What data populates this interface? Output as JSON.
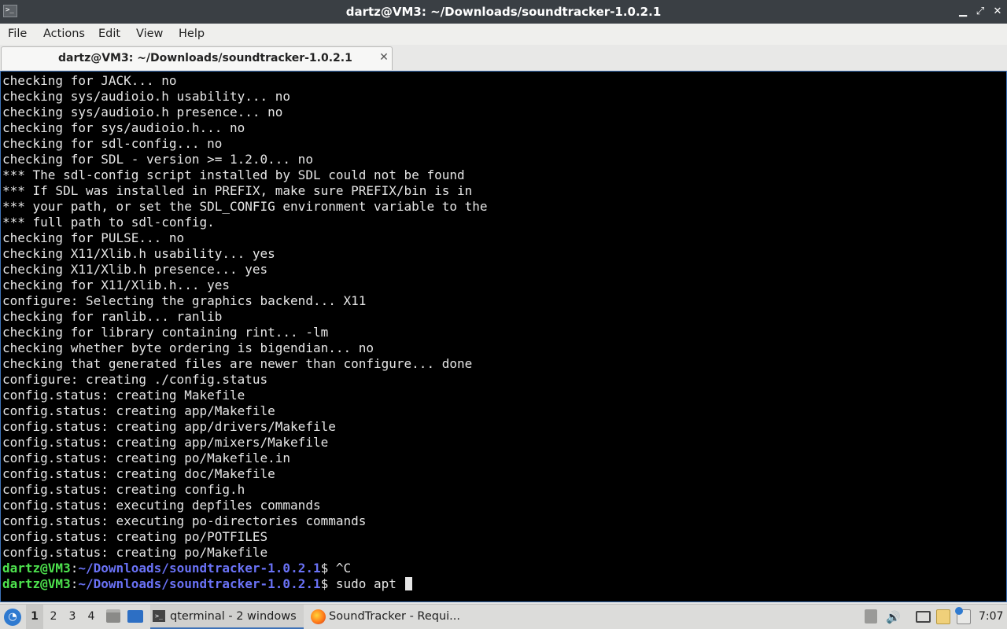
{
  "window": {
    "title": "dartz@VM3: ~/Downloads/soundtracker-1.0.2.1",
    "controls": {
      "minimize": "▁",
      "maximize": "⤢",
      "close": "✕"
    }
  },
  "menubar": {
    "items": [
      "File",
      "Actions",
      "Edit",
      "View",
      "Help"
    ]
  },
  "tabs": [
    {
      "label": "dartz@VM3: ~/Downloads/soundtracker-1.0.2.1",
      "active": true
    }
  ],
  "terminal": {
    "lines": [
      "checking for JACK... no",
      "checking sys/audioio.h usability... no",
      "checking sys/audioio.h presence... no",
      "checking for sys/audioio.h... no",
      "checking for sdl-config... no",
      "checking for SDL - version >= 1.2.0... no",
      "*** The sdl-config script installed by SDL could not be found",
      "*** If SDL was installed in PREFIX, make sure PREFIX/bin is in",
      "*** your path, or set the SDL_CONFIG environment variable to the",
      "*** full path to sdl-config.",
      "checking for PULSE... no",
      "checking X11/Xlib.h usability... yes",
      "checking X11/Xlib.h presence... yes",
      "checking for X11/Xlib.h... yes",
      "configure: Selecting the graphics backend... X11",
      "checking for ranlib... ranlib",
      "checking for library containing rint... -lm",
      "checking whether byte ordering is bigendian... no",
      "checking that generated files are newer than configure... done",
      "configure: creating ./config.status",
      "config.status: creating Makefile",
      "config.status: creating app/Makefile",
      "config.status: creating app/drivers/Makefile",
      "config.status: creating app/mixers/Makefile",
      "config.status: creating po/Makefile.in",
      "config.status: creating doc/Makefile",
      "config.status: creating config.h",
      "config.status: executing depfiles commands",
      "config.status: executing po-directories commands",
      "config.status: creating po/POTFILES",
      "config.status: creating po/Makefile"
    ],
    "prompts": [
      {
        "user": "dartz@VM3",
        "sep": ":",
        "path": "~/Downloads/soundtracker-1.0.2.1",
        "symbol": "$ ",
        "command": "^C"
      },
      {
        "user": "dartz@VM3",
        "sep": ":",
        "path": "~/Downloads/soundtracker-1.0.2.1",
        "symbol": "$ ",
        "command": "sudo apt "
      }
    ],
    "colors": {
      "background": "#000000",
      "text": "#e6e6e6",
      "user": "#4ee34e",
      "path": "#6a72f6"
    }
  },
  "taskbar": {
    "start_icon": "start-menu-icon",
    "workspaces": [
      "1",
      "2",
      "3",
      "4"
    ],
    "active_workspace": "1",
    "tasks": [
      {
        "label": "qterminal - 2 windows",
        "icon": "terminal-icon",
        "active": true
      },
      {
        "label": "SoundTracker - Requi...",
        "icon": "firefox-icon",
        "active": false
      }
    ],
    "tray": [
      "disk-icon",
      "volume-icon",
      "network-icon",
      "clipboard-icon",
      "update-icon"
    ],
    "clock": "7:07"
  }
}
